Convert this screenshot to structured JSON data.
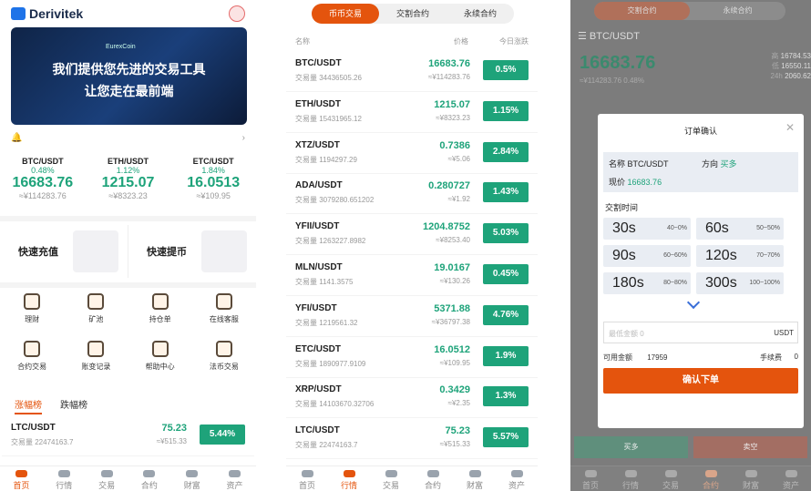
{
  "home": {
    "brand": "Derivitek",
    "banner_label": "EurexCoin",
    "banner_line1": "我们提供您先进的交易工具",
    "banner_line2": "让您走在最前端",
    "tickers": [
      {
        "pair": "BTC/USDT",
        "pct": "0.48%",
        "price": "16683.76",
        "cny": "≈¥114283.76"
      },
      {
        "pair": "ETH/USDT",
        "pct": "1.12%",
        "price": "1215.07",
        "cny": "≈¥8323.23"
      },
      {
        "pair": "ETC/USDT",
        "pct": "1.84%",
        "price": "16.0513",
        "cny": "≈¥109.95"
      }
    ],
    "quick": [
      "快速充值",
      "快速提币"
    ],
    "grid": [
      [
        "理财",
        "矿池",
        "持仓单",
        "在线客服"
      ],
      [
        "合约交易",
        "账变记录",
        "帮助中心",
        "法币交易"
      ]
    ],
    "rank_tabs": [
      "涨幅榜",
      "跌幅榜"
    ],
    "rank_row": {
      "pair": "LTC/USDT",
      "vol": "交易量 22474163.7",
      "price": "75.23",
      "cny": "≈¥515.33",
      "chg": "5.44%"
    }
  },
  "market": {
    "tabs": [
      "币币交易",
      "交割合约",
      "永续合约"
    ],
    "headers": {
      "name": "名称",
      "price": "价格",
      "change": "今日涨跌"
    },
    "rows": [
      {
        "pair": "BTC/USDT",
        "vol": "交易量 34436505.26",
        "price": "16683.76",
        "cny": "≈¥114283.76",
        "chg": "0.5%"
      },
      {
        "pair": "ETH/USDT",
        "vol": "交易量 15431965.12",
        "price": "1215.07",
        "cny": "≈¥8323.23",
        "chg": "1.15%"
      },
      {
        "pair": "XTZ/USDT",
        "vol": "交易量 1194297.29",
        "price": "0.7386",
        "cny": "≈¥5.06",
        "chg": "2.84%"
      },
      {
        "pair": "ADA/USDT",
        "vol": "交易量 3079280.651202",
        "price": "0.280727",
        "cny": "≈¥1.92",
        "chg": "1.43%"
      },
      {
        "pair": "YFII/USDT",
        "vol": "交易量 1263227.8982",
        "price": "1204.8752",
        "cny": "≈¥8253.40",
        "chg": "5.03%"
      },
      {
        "pair": "MLN/USDT",
        "vol": "交易量 1141.3575",
        "price": "19.0167",
        "cny": "≈¥130.26",
        "chg": "0.45%"
      },
      {
        "pair": "YFI/USDT",
        "vol": "交易量 1219561.32",
        "price": "5371.88",
        "cny": "≈¥36797.38",
        "chg": "4.76%"
      },
      {
        "pair": "ETC/USDT",
        "vol": "交易量 1890977.9109",
        "price": "16.0512",
        "cny": "≈¥109.95",
        "chg": "1.9%"
      },
      {
        "pair": "XRP/USDT",
        "vol": "交易量 14103670.32706",
        "price": "0.3429",
        "cny": "≈¥2.35",
        "chg": "1.3%"
      },
      {
        "pair": "LTC/USDT",
        "vol": "交易量 22474163.7",
        "price": "75.23",
        "cny": "≈¥515.33",
        "chg": "5.57%"
      }
    ]
  },
  "tabbar": [
    "首页",
    "行情",
    "交易",
    "合约",
    "财富",
    "资产"
  ],
  "contract": {
    "tabs": [
      "交割合约",
      "永续合约"
    ],
    "pair": "BTC/USDT",
    "price": "16683.76",
    "sub": "≈¥114283.76 0.48%",
    "stats": [
      [
        "高",
        "16784.53"
      ],
      [
        "低",
        "16550.11"
      ],
      [
        "24h",
        "2060.62"
      ]
    ],
    "buy": "买多",
    "sell": "卖空",
    "modal": {
      "title": "订单确认",
      "name_label": "名称",
      "name": "BTC/USDT",
      "dir_label": "方向",
      "dir": "买多",
      "now_label": "现价",
      "now": "16683.76",
      "time_label": "交割时间",
      "options": [
        {
          "s": "30s",
          "r": "40~0%"
        },
        {
          "s": "60s",
          "r": "50~50%"
        },
        {
          "s": "90s",
          "r": "60~60%"
        },
        {
          "s": "120s",
          "r": "70~70%"
        },
        {
          "s": "180s",
          "r": "80~80%"
        },
        {
          "s": "300s",
          "r": "100~100%"
        }
      ],
      "amount_placeholder": "最低金额 0",
      "unit": "USDT",
      "avail_label": "可用金额",
      "avail": "17959",
      "fee_label": "手续费",
      "fee": "0",
      "confirm": "确认下单"
    }
  }
}
